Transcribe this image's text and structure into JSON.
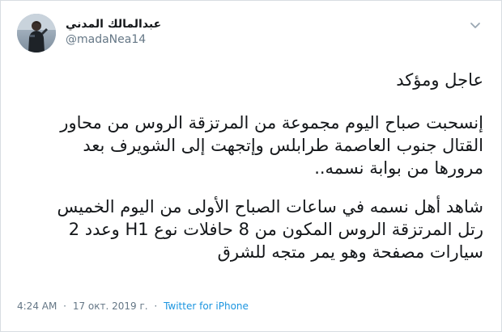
{
  "user": {
    "display_name": "عبدالمالك المدني",
    "handle": "@madaNea14"
  },
  "tweet": {
    "paragraph1": "عاجل ومؤكد",
    "paragraph2": "إنسحبت صباح اليوم مجموعة من المرتزقة الروس من محاور القتال جنوب العاصمة طرابلس وإتجهت إلى الشويرف بعد مرورها من بوابة نسمه..",
    "paragraph3": "شاهد أهل نسمه في ساعات الصباح الأولى من اليوم الخميس رتل المرتزقة الروس المكون من 8 حافلات نوع H1 وعدد 2 سيارات مصفحة وهو يمر متجه للشرق"
  },
  "footer": {
    "time": "4:24 AM",
    "separator": "·",
    "date": "17 окт. 2019 г.",
    "source": "Twitter for iPhone"
  },
  "icons": {
    "avatar": "user-avatar-photo",
    "caret": "chevron-down-icon"
  },
  "colors": {
    "text_primary": "#14171a",
    "text_secondary": "#657786",
    "link": "#1b95e0",
    "border": "#d8dde2"
  }
}
